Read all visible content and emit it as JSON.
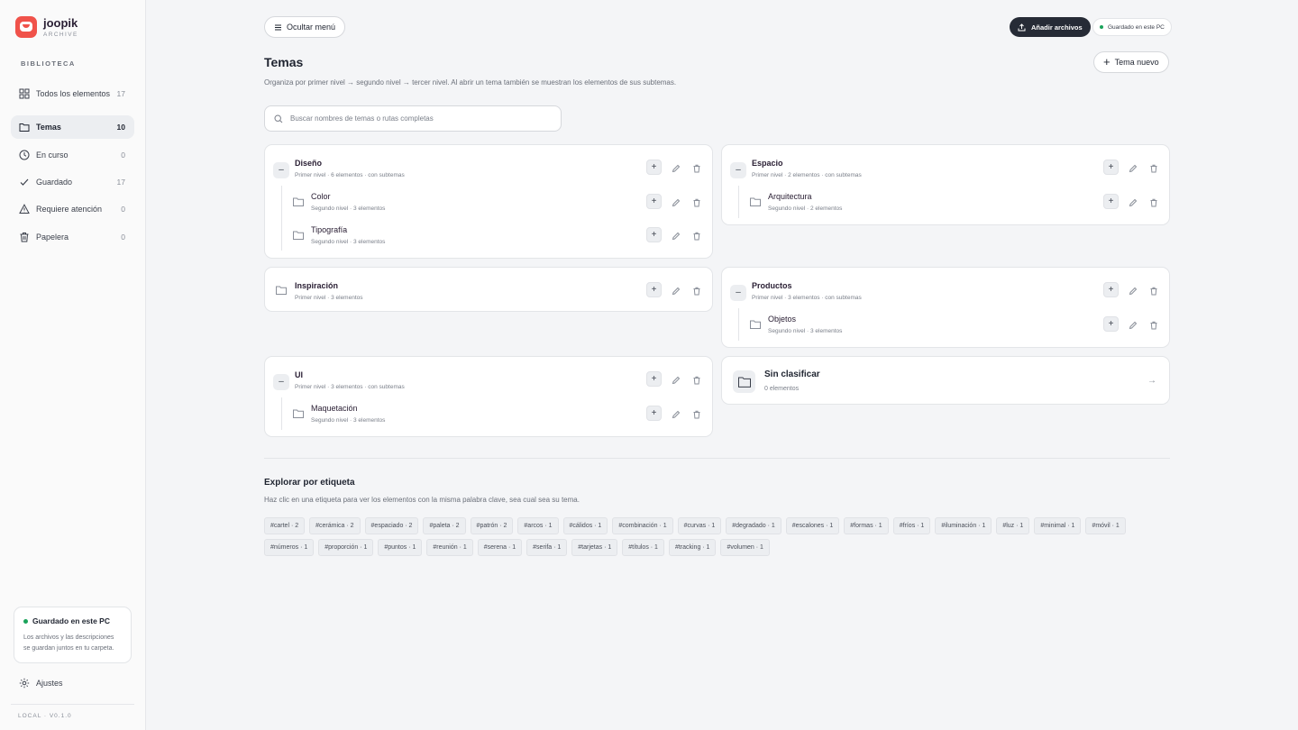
{
  "app": {
    "name": "joopik",
    "subtitle": "ARCHIVE",
    "version": "LOCAL · V0.1.0"
  },
  "sidebar": {
    "section_title": "BIBLIOTECA",
    "items": [
      {
        "label": "Todos los elementos",
        "count": "17",
        "icon": "grid-icon"
      },
      {
        "label": "Temas",
        "count": "10",
        "icon": "folder-icon",
        "active": true
      },
      {
        "label": "En curso",
        "count": "0",
        "icon": "clock-icon"
      },
      {
        "label": "Guardado",
        "count": "17",
        "icon": "check-icon"
      },
      {
        "label": "Requiere atención",
        "count": "0",
        "icon": "warning-icon"
      },
      {
        "label": "Papelera",
        "count": "0",
        "icon": "trash-icon"
      }
    ],
    "save_card": {
      "title": "Guardado en este PC",
      "description": "Los archivos y las descripciones se guardan juntos en tu carpeta."
    },
    "settings_label": "Ajustes"
  },
  "toolbar": {
    "hide_menu_label": "Ocultar menú",
    "add_files_label": "Añadir archivos",
    "saved_status": "Guardado en este PC"
  },
  "page": {
    "title": "Temas",
    "description": "Organiza por primer nivel → segundo nivel → tercer nivel. Al abrir un tema también se muestran los elementos de sus subtemas.",
    "new_topic_label": "Tema nuevo",
    "search_placeholder": "Buscar nombres de temas o rutas completas"
  },
  "topics": {
    "diseno": {
      "name": "Diseño",
      "meta": "Primer nivel · 6 elementos · con subtemas",
      "children": [
        {
          "name": "Color",
          "meta": "Segundo nivel · 3 elementos"
        },
        {
          "name": "Tipografía",
          "meta": "Segundo nivel · 3 elementos"
        }
      ]
    },
    "espacio": {
      "name": "Espacio",
      "meta": "Primer nivel · 2 elementos · con subtemas",
      "children": [
        {
          "name": "Arquitectura",
          "meta": "Segundo nivel · 2 elementos"
        }
      ]
    },
    "inspiracion": {
      "name": "Inspiración",
      "meta": "Primer nivel · 3 elementos"
    },
    "productos": {
      "name": "Productos",
      "meta": "Primer nivel · 3 elementos · con subtemas",
      "children": [
        {
          "name": "Objetos",
          "meta": "Segundo nivel · 3 elementos"
        }
      ]
    },
    "ui": {
      "name": "UI",
      "meta": "Primer nivel · 3 elementos · con subtemas",
      "children": [
        {
          "name": "Maquetación",
          "meta": "Segundo nivel · 3 elementos"
        }
      ]
    },
    "unclassified": {
      "name": "Sin clasificar",
      "meta": "0 elementos"
    }
  },
  "tags_section": {
    "title": "Explorar por etiqueta",
    "description": "Haz clic en una etiqueta para ver los elementos con la misma palabra clave, sea cual sea su tema.",
    "tags": [
      "#cartel · 2",
      "#cerámica · 2",
      "#espaciado · 2",
      "#paleta · 2",
      "#patrón · 2",
      "#arcos · 1",
      "#cálidos · 1",
      "#combinación · 1",
      "#curvas · 1",
      "#degradado · 1",
      "#escalones · 1",
      "#formas · 1",
      "#fríos · 1",
      "#iluminación · 1",
      "#luz · 1",
      "#minimal · 1",
      "#móvil · 1",
      "#números · 1",
      "#proporción · 1",
      "#puntos · 1",
      "#reunión · 1",
      "#serena · 1",
      "#serifa · 1",
      "#tarjetas · 1",
      "#títulos · 1",
      "#tracking · 1",
      "#volumen · 1"
    ]
  },
  "colors": {
    "accent": "#f0524a",
    "dark_button": "#262b36",
    "status_green": "#1aa35a"
  }
}
